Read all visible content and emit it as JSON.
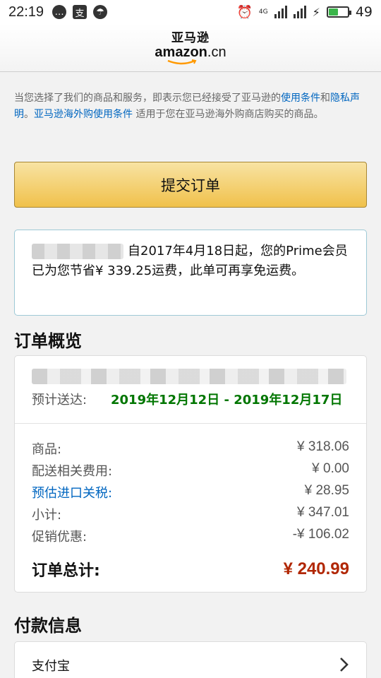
{
  "status_bar": {
    "time": "22:19",
    "network": "4G",
    "battery": "49",
    "battery_level": 0.49
  },
  "header": {
    "logo_cn": "亚马逊",
    "logo_en": "amazon",
    "logo_suffix": ".cn"
  },
  "notice": {
    "part1": "当您选择了我们的商品和服务，即表示您已经接受了亚马逊的",
    "link_terms": "使用条件",
    "and": "和",
    "link_privacy": "隐私声明",
    "period": "。",
    "link_global_terms": "亚马逊海外购使用条件",
    "part2": " 适用于您在亚马逊海外购商店购买的商品。"
  },
  "submit_button": "提交订单",
  "prime_box": {
    "message": "自2017年4月18日起，您的Prime会员已为您节省¥ 339.25运费，此单可再享免运费。"
  },
  "overview": {
    "title": "订单概览",
    "eta_label": "预计送达:",
    "eta_date": "2019年12月12日 - 2019年12月17日",
    "rows": [
      {
        "label": "商品:",
        "value": "¥ 318.06"
      },
      {
        "label": "配送相关费用:",
        "value": "¥ 0.00"
      },
      {
        "label": "预估进口关税:",
        "value": "¥ 28.95"
      },
      {
        "label": "小计:",
        "value": "¥ 347.01"
      },
      {
        "label": "促销优惠:",
        "value": "-¥ 106.02"
      }
    ],
    "total_label": "订单总计:",
    "total_value": "¥ 240.99"
  },
  "payment": {
    "title": "付款信息",
    "method": "支付宝"
  },
  "colors": {
    "link": "#0066c0",
    "price_total": "#b12704",
    "eta": "#007600",
    "button": "#f0c14b"
  }
}
